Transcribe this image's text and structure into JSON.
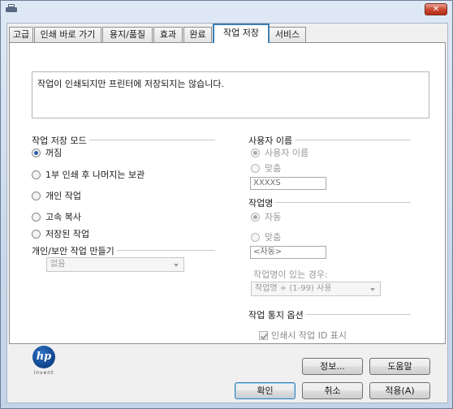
{
  "tabs": [
    "고급",
    "인쇄 바로 가기",
    "용지/품질",
    "효과",
    "완료",
    "작업 저장",
    "서비스"
  ],
  "active_tab": "작업 저장",
  "description": "작업이 인쇄되지만 프린터에 저장되지는 않습니다.",
  "job_storage_mode": {
    "title": "작업 저장 모드",
    "options": [
      "꺼짐",
      "1부 인쇄 후 나머지는 보관",
      "개인 작업",
      "고속 복사",
      "저장된 작업"
    ],
    "selected": "꺼짐"
  },
  "private_job": {
    "title": "개인/보안 작업 만들기",
    "value": "없음"
  },
  "user_name": {
    "title": "사용자 이름",
    "options": [
      "사용자 이름",
      "맞춤"
    ],
    "selected": "사용자 이름",
    "value": "XXXXS"
  },
  "job_name": {
    "title": "작업명",
    "options": [
      "자동",
      "맞춤"
    ],
    "selected": "자동",
    "value": "<자동>",
    "exists_label": "작업명이 있는 경우:",
    "exists_value": "작업명 + (1-99) 사용"
  },
  "notification": {
    "title": "작업 통지 옵션",
    "checkbox_label": "인쇄시 작업 ID 표시",
    "checked": true
  },
  "logo_text": "invent",
  "buttons": {
    "info": "정보...",
    "help": "도움말",
    "ok": "확인",
    "cancel": "취소",
    "apply": "적용(A)"
  },
  "colors": {
    "active_tab_border": "#3c7fb1",
    "logo_blue": "#0b3f86",
    "close_red": "#c7442d"
  }
}
